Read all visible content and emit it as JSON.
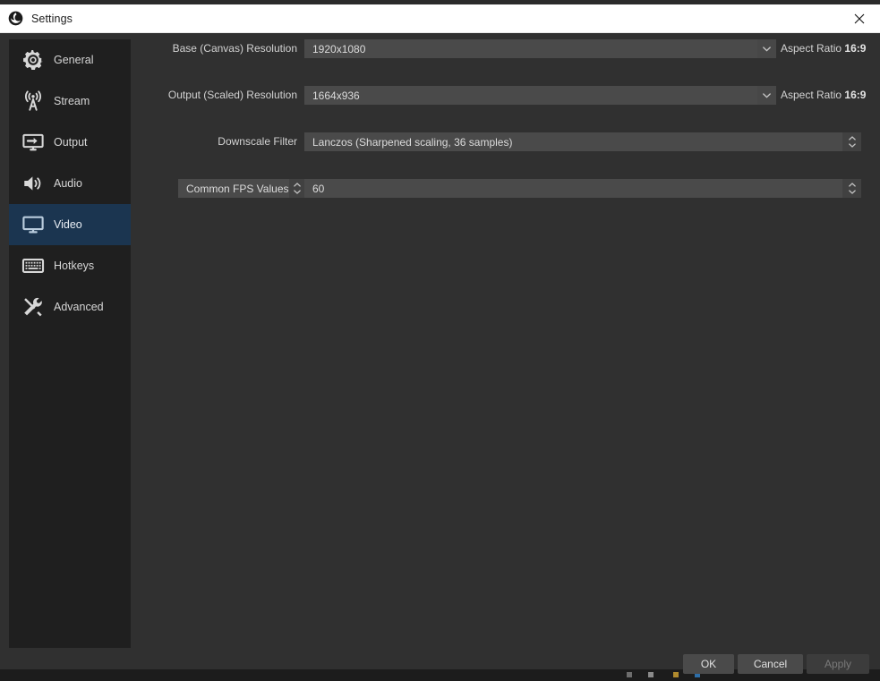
{
  "window": {
    "title": "Settings",
    "app_icon": "obs-logo-icon",
    "close_icon": "close-icon"
  },
  "colors": {
    "dialog_bg": "#303030",
    "sidebar_bg": "#1f1f1f",
    "selected_item_bg": "#1b3550",
    "field_bg": "#4a4a4a",
    "titlebar_bg": "#ffffff",
    "text": "#d2d2d2"
  },
  "sidebar": {
    "items": [
      {
        "label": "General",
        "icon": "gear-icon",
        "selected": false
      },
      {
        "label": "Stream",
        "icon": "broadcast-tower-icon",
        "selected": false
      },
      {
        "label": "Output",
        "icon": "monitor-arrow-icon",
        "selected": false
      },
      {
        "label": "Audio",
        "icon": "speaker-icon",
        "selected": false
      },
      {
        "label": "Video",
        "icon": "monitor-icon",
        "selected": true
      },
      {
        "label": "Hotkeys",
        "icon": "keyboard-icon",
        "selected": false
      },
      {
        "label": "Advanced",
        "icon": "wrench-screwdriver-icon",
        "selected": false
      }
    ]
  },
  "video_settings": {
    "rows": [
      {
        "label": "Base (Canvas) Resolution",
        "value": "1920x1080",
        "control": "editable-combobox",
        "dropdown_icon": "chevron-down-icon",
        "suffix_label": "Aspect Ratio",
        "suffix_value": "16:9"
      },
      {
        "label": "Output (Scaled) Resolution",
        "value": "1664x936",
        "control": "editable-combobox",
        "dropdown_icon": "chevron-down-icon",
        "suffix_label": "Aspect Ratio",
        "suffix_value": "16:9"
      },
      {
        "label": "Downscale Filter",
        "value": "Lanczos (Sharpened scaling, 36 samples)",
        "control": "spinner-combobox",
        "spinner_icon": "spinner-updown-icon"
      },
      {
        "label": "Common FPS Values",
        "label_is_combo": true,
        "label_spinner_icon": "spinner-updown-icon",
        "value": "60",
        "control": "spinner-combobox",
        "spinner_icon": "spinner-updown-icon"
      }
    ]
  },
  "buttons": {
    "ok": "OK",
    "cancel": "Cancel",
    "apply": "Apply",
    "apply_enabled": false
  }
}
